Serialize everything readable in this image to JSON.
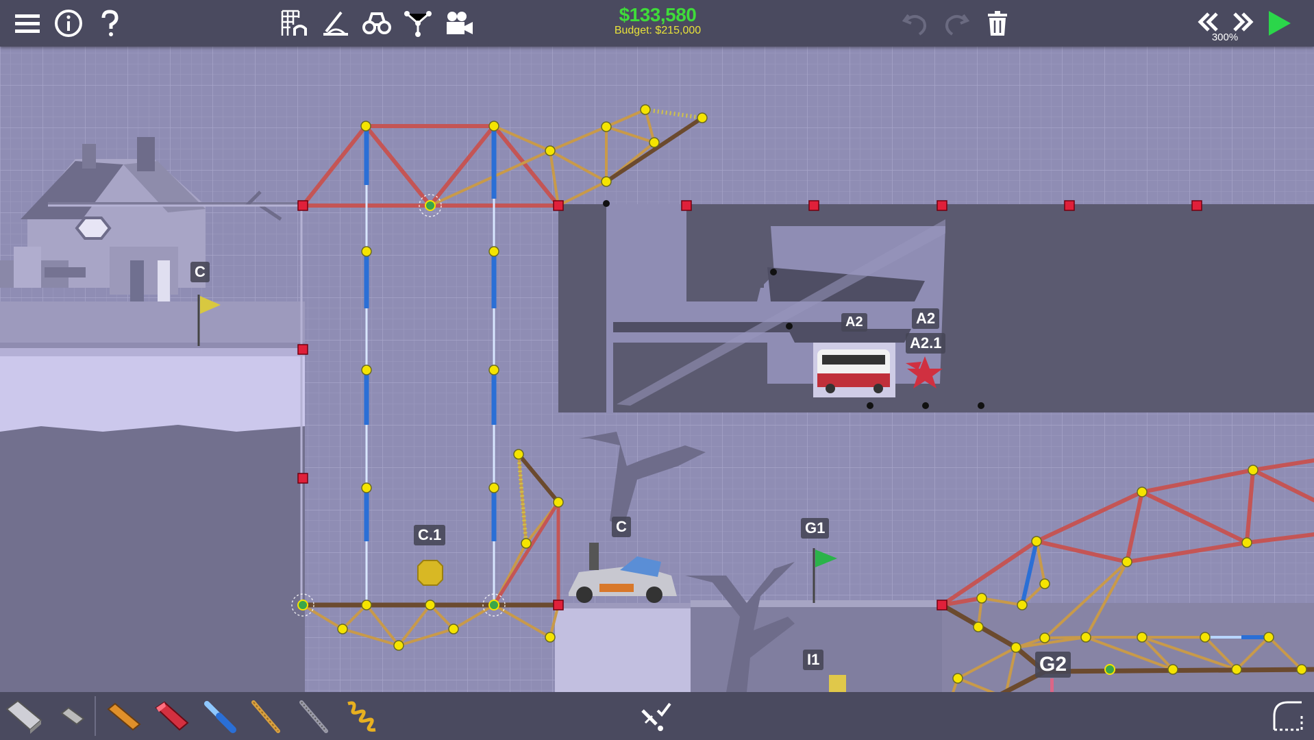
{
  "hud": {
    "cost": "$133,580",
    "budget": "Budget: $215,000",
    "zoom": "300%"
  },
  "labels": {
    "c_house": "C",
    "c1": "C.1",
    "c_car": "C",
    "g1": "G1",
    "a2_bus": "A2",
    "a2_star": "A2",
    "a21": "A2.1",
    "i1": "I1",
    "g2": "G2"
  },
  "colors": {
    "background": "#8f8db4",
    "toolbar": "#4a4a5f",
    "cost_green": "#3fdc3a",
    "budget_yellow": "#e8e23a",
    "steel_red": "#c45555",
    "wood_tan": "#c89a4a",
    "road_brown": "#6b4a2e",
    "hydraulic_blue": "#2a6fd6",
    "joint_yellow": "#f5e400",
    "anchor_red": "#e0203a"
  },
  "icons": {
    "top_left": [
      "menu-icon",
      "info-icon",
      "help-icon"
    ],
    "top_center": [
      "grid-toggle-icon",
      "stress-view-icon",
      "binoculars-icon",
      "joint-graph-icon",
      "camera-icon"
    ],
    "top_edit": [
      "undo-icon",
      "redo-icon",
      "trash-icon"
    ],
    "top_right": [
      "slower-icon",
      "faster-icon",
      "play-icon"
    ],
    "materials": [
      "road-material-icon",
      "reinforced-road-icon",
      "wood-beam-icon",
      "steel-beam-icon",
      "hydraulic-icon",
      "rope-icon",
      "cable-icon",
      "spring-icon"
    ],
    "bottom": [
      "auto-split-icon",
      "corner-toggle-icon"
    ]
  }
}
